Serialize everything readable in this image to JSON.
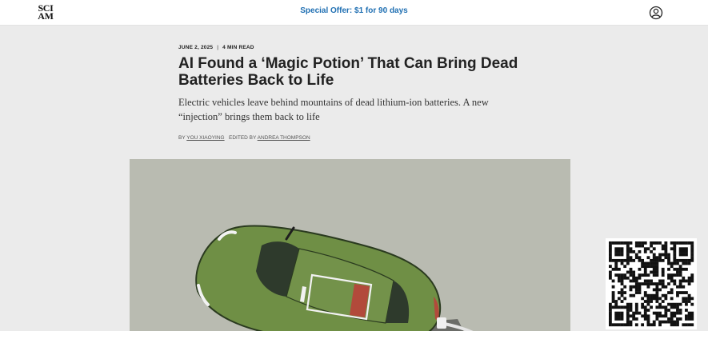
{
  "header": {
    "logo_line1": "SCI",
    "logo_line2": "AM",
    "offer": "Special Offer: $1 for 90 days",
    "account_icon": "user-circle-icon"
  },
  "article": {
    "date": "JUNE 2, 2025",
    "separator": "|",
    "read_time": "4 MIN READ",
    "title": "AI Found a ‘Magic Potion’ That Can Bring Dead Batteries Back to Life",
    "dek": "Electric vehicles leave behind mountains of dead lithium-ion batteries. A new “injection” brings them back to life",
    "by_label": "BY",
    "author": "YOU XIAOYING",
    "edited_label": "EDITED BY",
    "editor": "ANDREA THOMPSON"
  },
  "hero": {
    "icon": "car-battery-illustration",
    "bg_color": "#b9bbb1",
    "car_color": "#6f8f45"
  },
  "qr": {
    "icon": "qr-code-icon"
  }
}
